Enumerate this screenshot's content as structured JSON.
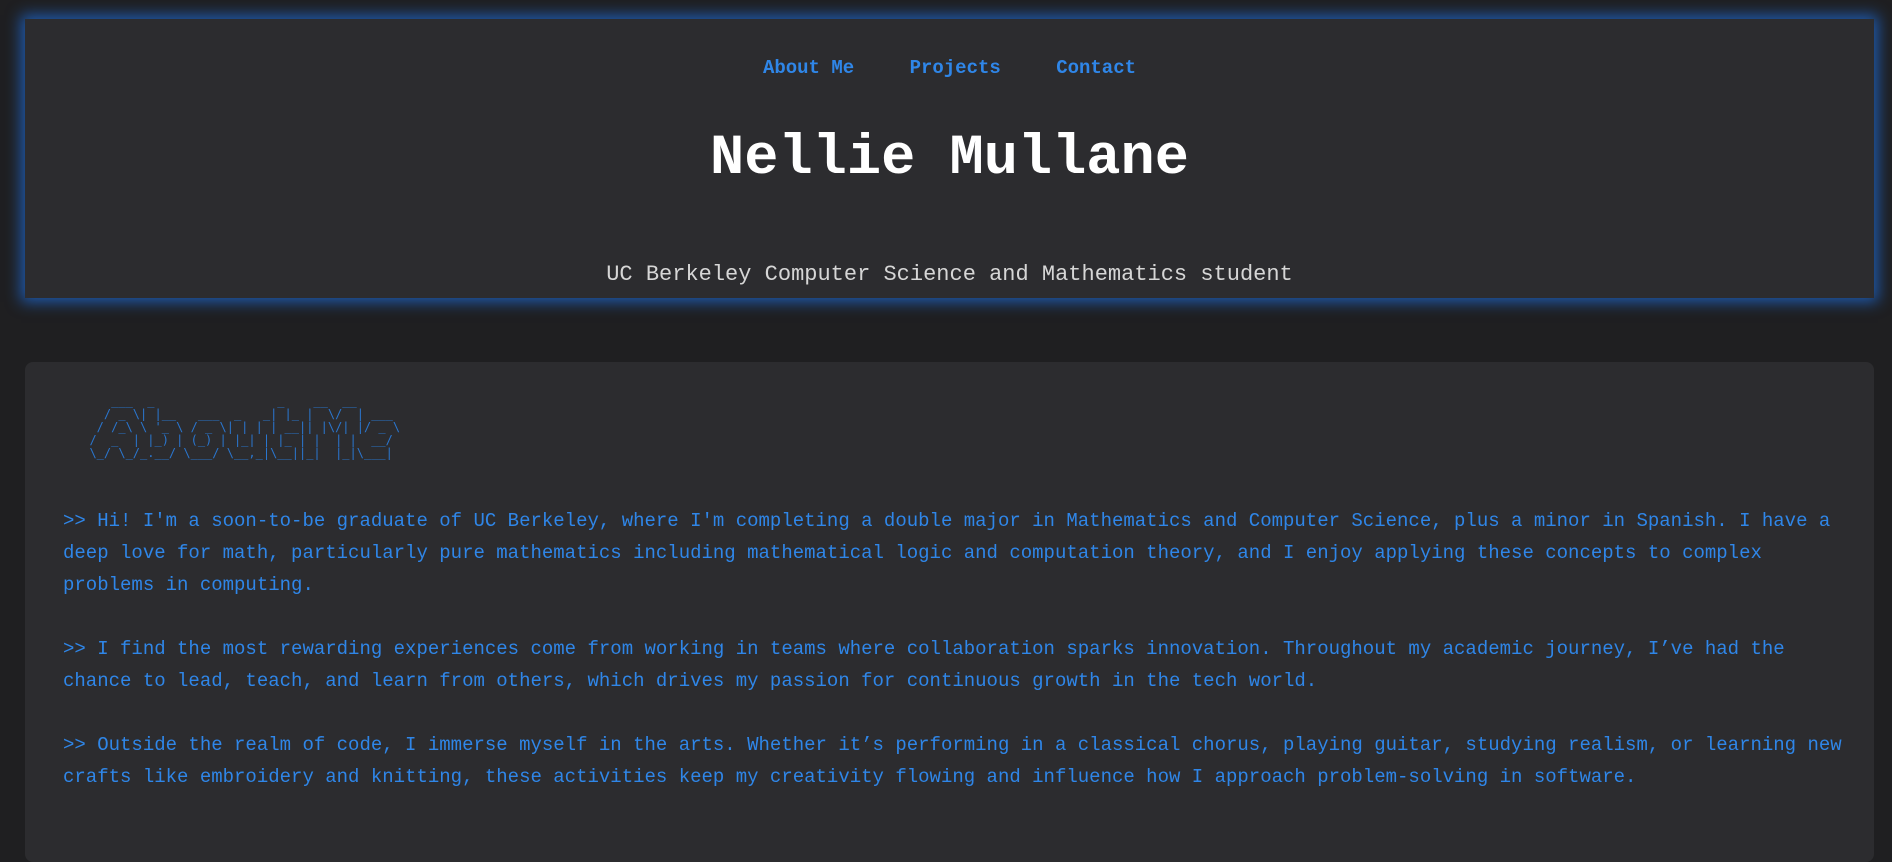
{
  "nav": {
    "items": [
      "About Me",
      "Projects",
      "Contact"
    ]
  },
  "header": {
    "title": "Nellie Mullane",
    "subtitle": "UC Berkeley Computer Science and Mathematics student"
  },
  "about": {
    "ascii_heading": "     ___  _                 _    __  __\n    / _ \\| |__   ___  _   _| |_ |  \\/  | ___\n   / /_\\ \\ '_ \\ / _ \\| | | | __|| |\\/| |/ _ \\\n  /  _  | |_) | (_) | |_| | |_ | |  | |  __/\n  \\_/ \\_/_.__/ \\___/ \\__,_|\\__||_|  |_|\\___|",
    "paragraphs": [
      ">> Hi! I'm a soon-to-be graduate of UC Berkeley, where I'm completing a double major in Mathematics and Computer Science, plus a minor in Spanish. I have a deep love for math, particularly pure mathematics including mathematical logic and computation theory, and I enjoy applying these concepts to complex problems in computing.",
      ">> I find the most rewarding experiences come from working in teams where collaboration sparks innovation. Throughout my academic journey, I’ve had the chance to lead, teach, and learn from others, which drives my passion for continuous growth in the tech world.",
      ">> Outside the realm of code, I immerse myself in the arts. Whether it’s performing in a classical chorus, playing guitar, studying realism, or learning new crafts like embroidery and knitting, these activities keep my creativity flowing and influence how I approach problem-solving in software."
    ]
  },
  "colors": {
    "accent": "#2f86e8",
    "background": "#1f1f21",
    "panel": "#2c2c2f"
  }
}
